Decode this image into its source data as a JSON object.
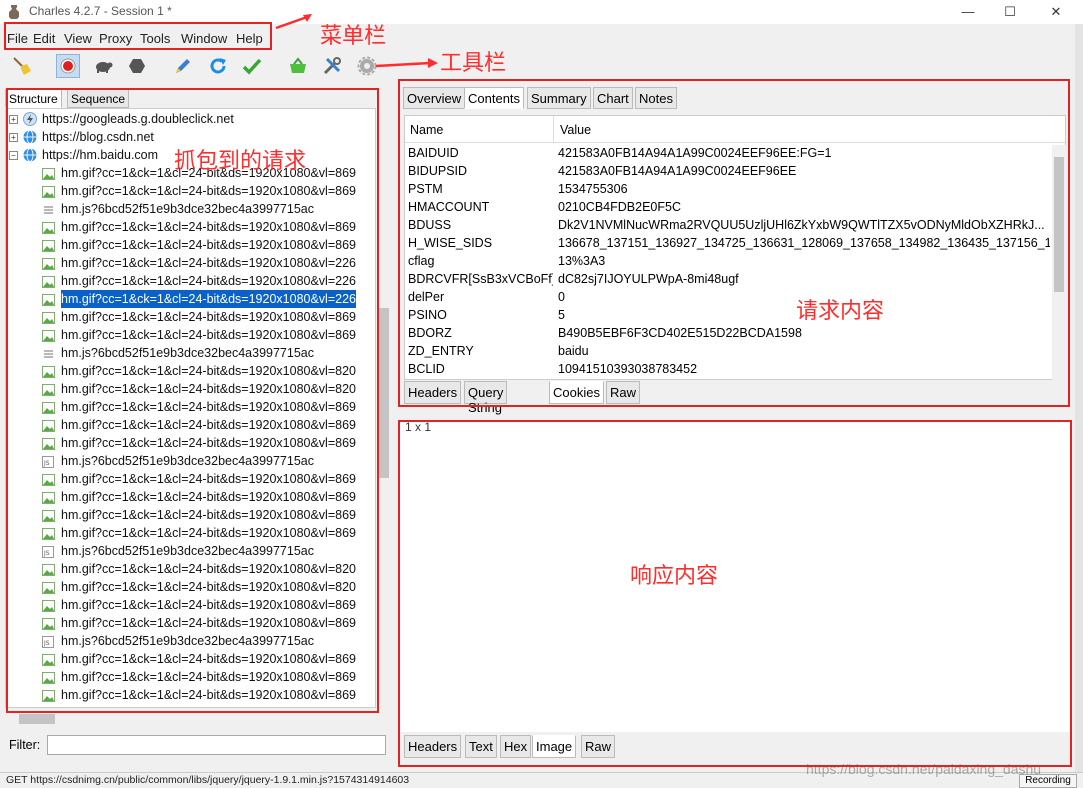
{
  "window": {
    "title": "Charles 4.2.7 - Session 1 *",
    "minimize": "—",
    "maximize": "☐",
    "close": "✕"
  },
  "menu": [
    "File",
    "Edit",
    "View",
    "Proxy",
    "Tools",
    "Window",
    "Help"
  ],
  "toolbar": {
    "icons": [
      "broom-icon",
      "record-icon",
      "throttle-turtle-icon",
      "breakpoint-hexagon-icon",
      "pen-icon",
      "refresh-icon",
      "check-icon",
      "basket-icon",
      "tools-icon",
      "settings-gear-icon"
    ]
  },
  "left_tabs": [
    "Structure",
    "Sequence"
  ],
  "tree": {
    "hosts": [
      {
        "label": "https://googleads.g.doubleclick.net",
        "expanded": false,
        "icon": "lightning-icon"
      },
      {
        "label": "https://blog.csdn.net",
        "expanded": false,
        "icon": "globe-icon"
      },
      {
        "label": "https://hm.baidu.com",
        "expanded": true,
        "icon": "globe-icon"
      }
    ],
    "children": [
      {
        "label": "hm.gif?cc=1&ck=1&cl=24-bit&ds=1920x1080&vl=869",
        "kind": "image"
      },
      {
        "label": "hm.gif?cc=1&ck=1&cl=24-bit&ds=1920x1080&vl=869",
        "kind": "image"
      },
      {
        "label": "hm.js?6bcd52f51e9b3dce32bec4a3997715ac",
        "kind": "lines"
      },
      {
        "label": "hm.gif?cc=1&ck=1&cl=24-bit&ds=1920x1080&vl=869",
        "kind": "image"
      },
      {
        "label": "hm.gif?cc=1&ck=1&cl=24-bit&ds=1920x1080&vl=869",
        "kind": "image"
      },
      {
        "label": "hm.gif?cc=1&ck=1&cl=24-bit&ds=1920x1080&vl=226",
        "kind": "image"
      },
      {
        "label": "hm.gif?cc=1&ck=1&cl=24-bit&ds=1920x1080&vl=226",
        "kind": "image"
      },
      {
        "label": "hm.gif?cc=1&ck=1&cl=24-bit&ds=1920x1080&vl=226",
        "kind": "image",
        "selected": true
      },
      {
        "label": "hm.gif?cc=1&ck=1&cl=24-bit&ds=1920x1080&vl=869",
        "kind": "image"
      },
      {
        "label": "hm.gif?cc=1&ck=1&cl=24-bit&ds=1920x1080&vl=869",
        "kind": "image"
      },
      {
        "label": "hm.js?6bcd52f51e9b3dce32bec4a3997715ac",
        "kind": "lines"
      },
      {
        "label": "hm.gif?cc=1&ck=1&cl=24-bit&ds=1920x1080&vl=820",
        "kind": "image"
      },
      {
        "label": "hm.gif?cc=1&ck=1&cl=24-bit&ds=1920x1080&vl=820",
        "kind": "image"
      },
      {
        "label": "hm.gif?cc=1&ck=1&cl=24-bit&ds=1920x1080&vl=869",
        "kind": "image"
      },
      {
        "label": "hm.gif?cc=1&ck=1&cl=24-bit&ds=1920x1080&vl=869",
        "kind": "image"
      },
      {
        "label": "hm.gif?cc=1&ck=1&cl=24-bit&ds=1920x1080&vl=869",
        "kind": "image"
      },
      {
        "label": "hm.js?6bcd52f51e9b3dce32bec4a3997715ac",
        "kind": "js"
      },
      {
        "label": "hm.gif?cc=1&ck=1&cl=24-bit&ds=1920x1080&vl=869",
        "kind": "image"
      },
      {
        "label": "hm.gif?cc=1&ck=1&cl=24-bit&ds=1920x1080&vl=869",
        "kind": "image"
      },
      {
        "label": "hm.gif?cc=1&ck=1&cl=24-bit&ds=1920x1080&vl=869",
        "kind": "image"
      },
      {
        "label": "hm.gif?cc=1&ck=1&cl=24-bit&ds=1920x1080&vl=869",
        "kind": "image"
      },
      {
        "label": "hm.js?6bcd52f51e9b3dce32bec4a3997715ac",
        "kind": "js"
      },
      {
        "label": "hm.gif?cc=1&ck=1&cl=24-bit&ds=1920x1080&vl=820",
        "kind": "image"
      },
      {
        "label": "hm.gif?cc=1&ck=1&cl=24-bit&ds=1920x1080&vl=820",
        "kind": "image"
      },
      {
        "label": "hm.gif?cc=1&ck=1&cl=24-bit&ds=1920x1080&vl=869",
        "kind": "image"
      },
      {
        "label": "hm.gif?cc=1&ck=1&cl=24-bit&ds=1920x1080&vl=869",
        "kind": "image"
      },
      {
        "label": "hm.js?6bcd52f51e9b3dce32bec4a3997715ac",
        "kind": "js"
      },
      {
        "label": "hm.gif?cc=1&ck=1&cl=24-bit&ds=1920x1080&vl=869",
        "kind": "image"
      },
      {
        "label": "hm.gif?cc=1&ck=1&cl=24-bit&ds=1920x1080&vl=869",
        "kind": "image"
      },
      {
        "label": "hm.gif?cc=1&ck=1&cl=24-bit&ds=1920x1080&vl=869",
        "kind": "image"
      }
    ]
  },
  "filter": {
    "label": "Filter:",
    "value": ""
  },
  "right_tabs": [
    "Overview",
    "Contents",
    "Summary",
    "Chart",
    "Notes"
  ],
  "right_tabs_selected": "Contents",
  "cookies_table": {
    "headers": {
      "name": "Name",
      "value": "Value"
    },
    "rows": [
      {
        "name": "BAIDUID",
        "value": "421583A0FB14A94A1A99C0024EEF96EE:FG=1"
      },
      {
        "name": "BIDUPSID",
        "value": "421583A0FB14A94A1A99C0024EEF96EE"
      },
      {
        "name": "PSTM",
        "value": "1534755306"
      },
      {
        "name": "HMACCOUNT",
        "value": "0210CB4FDB2E0F5C"
      },
      {
        "name": "BDUSS",
        "value": "Dk2V1NVMlNucWRma2RVQUU5UzljUHl6ZkYxbW9QWTlTZX5vODNyMldObXZHRkJ..."
      },
      {
        "name": "H_WISE_SIDS",
        "value": "136678_137151_136927_134725_136631_128069_137658_134982_136435_137156_1..."
      },
      {
        "name": "cflag",
        "value": "13%3A3"
      },
      {
        "name": "BDRCVFR[SsB3xVCBoFf]",
        "value": "dC82sj7IJOYULPWpA-8mi48ugf"
      },
      {
        "name": "delPer",
        "value": "0"
      },
      {
        "name": "PSINO",
        "value": "5"
      },
      {
        "name": "BDORZ",
        "value": "B490B5EBF6F3CD402E515D22BCDA1598"
      },
      {
        "name": "ZD_ENTRY",
        "value": "baidu"
      },
      {
        "name": "BCLID",
        "value": "10941510393038783452"
      }
    ]
  },
  "request_subtabs": [
    "Headers",
    "Query String",
    "Cookies",
    "Raw"
  ],
  "request_subtabs_selected": "Cookies",
  "response": {
    "text": "1 x 1"
  },
  "response_subtabs": [
    "Headers",
    "Text",
    "Hex",
    "Image",
    "Raw"
  ],
  "response_subtabs_selected": "Image",
  "status": {
    "text": "GET https://csdnimg.cn/public/common/libs/jquery/jquery-1.9.1.min.js?1574314914603",
    "recording": "Recording"
  },
  "watermark": "https://blog.csdn.net/paidaxing_dashu",
  "annotations": {
    "menubar": "菜单栏",
    "toolbar": "工具栏",
    "captured": "抓包到的请求",
    "request": "请求内容",
    "response": "响应内容",
    "color": "#ff2d2d"
  }
}
